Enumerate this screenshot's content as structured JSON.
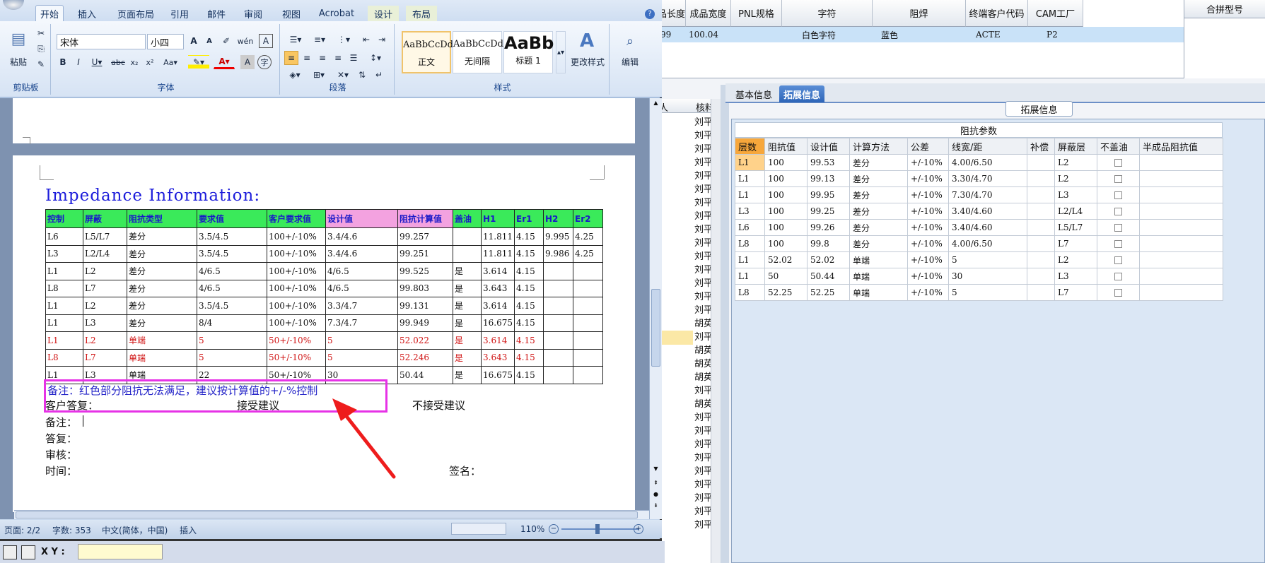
{
  "bg": {
    "top_headers": [
      "品长度",
      "成品宽度",
      "PNL规格",
      "字符",
      "阻焊",
      "终端客户代码",
      "CAM工厂"
    ],
    "top_row": [
      "99",
      "100.04",
      "",
      "白色字符",
      "蓝色",
      "ACTE",
      "P2"
    ],
    "right_header": "合拼型号",
    "mid_headers": [
      "人",
      "核料"
    ],
    "mid_names": [
      "刘平",
      "刘平",
      "刘平",
      "刘平",
      "刘平",
      "刘平",
      "刘平",
      "刘平",
      "刘平",
      "刘平",
      "刘平",
      "刘平",
      "刘平",
      "刘平",
      "刘平",
      "胡英",
      "刘平",
      "胡英",
      "胡英",
      "胡英",
      "刘平",
      "胡英",
      "刘平",
      "刘平",
      "刘平",
      "刘平",
      "刘平",
      "刘平",
      "刘平",
      "刘平",
      "刘平"
    ],
    "tabs": [
      "基本信息",
      "拓展信息"
    ],
    "legend": "拓展信息",
    "grid_title": "阻抗参数",
    "grid_headers": [
      "层数",
      "阻抗值",
      "设计值",
      "计算方法",
      "公差",
      "线宽/距",
      "补偿",
      "屏蔽层",
      "不盖油",
      "半成品阻抗值"
    ],
    "grid_rows": [
      [
        "L1",
        "100",
        "99.53",
        "差分",
        "+/-10%",
        "4.00/6.50",
        "",
        "L2"
      ],
      [
        "L1",
        "100",
        "99.13",
        "差分",
        "+/-10%",
        "3.30/4.70",
        "",
        "L2"
      ],
      [
        "L1",
        "100",
        "99.95",
        "差分",
        "+/-10%",
        "7.30/4.70",
        "",
        "L3"
      ],
      [
        "L3",
        "100",
        "99.25",
        "差分",
        "+/-10%",
        "3.40/4.60",
        "",
        "L2/L4"
      ],
      [
        "L6",
        "100",
        "99.26",
        "差分",
        "+/-10%",
        "3.40/4.60",
        "",
        "L5/L7"
      ],
      [
        "L8",
        "100",
        "99.8",
        "差分",
        "+/-10%",
        "4.00/6.50",
        "",
        "L7"
      ],
      [
        "L1",
        "52.02",
        "52.02",
        "单端",
        "+/-10%",
        "5",
        "",
        "L2"
      ],
      [
        "L1",
        "50",
        "50.44",
        "单端",
        "+/-10%",
        "30",
        "",
        "L3"
      ],
      [
        "L8",
        "52.25",
        "52.25",
        "单端",
        "+/-10%",
        "5",
        "",
        "L7"
      ]
    ],
    "bottom_label": "X Y :"
  },
  "word": {
    "tabs": [
      "开始",
      "插入",
      "页面布局",
      "引用",
      "邮件",
      "审阅",
      "视图",
      "Acrobat",
      "设计",
      "布局"
    ],
    "font_name": "宋体",
    "font_size": "小四",
    "groups": [
      "剪贴板",
      "字体",
      "段落",
      "样式"
    ],
    "paste": "粘贴",
    "styles": [
      {
        "preview": "AaBbCcDd",
        "name": "正文"
      },
      {
        "preview": "AaBbCcDd",
        "name": "无间隔"
      },
      {
        "preview": "AaBb",
        "name": "标题 1"
      }
    ],
    "change_style": "更改样式",
    "edit": "编辑",
    "doc_title": "Impedance Information:",
    "table_headers": [
      "控制",
      "屏蔽",
      "阻抗类型",
      "要求值",
      "客户要求值",
      "设计值",
      "阻抗计算值",
      "盖油",
      "H1",
      "Er1",
      "H2",
      "Er2"
    ],
    "table_rows": [
      {
        "red": false,
        "cells": [
          "L6",
          "L5/L7",
          "差分",
          "3.5/4.5",
          "100+/-10%",
          "3.4/4.6",
          "99.257",
          "",
          "11.811",
          "4.15",
          "9.995",
          "4.25"
        ]
      },
      {
        "red": false,
        "cells": [
          "L3",
          "L2/L4",
          "差分",
          "3.5/4.5",
          "100+/-10%",
          "3.4/4.6",
          "99.251",
          "",
          "11.811",
          "4.15",
          "9.986",
          "4.25"
        ]
      },
      {
        "red": false,
        "cells": [
          "L1",
          "L2",
          "差分",
          "4/6.5",
          "100+/-10%",
          "4/6.5",
          "99.525",
          "是",
          "3.614",
          "4.15",
          "",
          ""
        ]
      },
      {
        "red": false,
        "cells": [
          "L8",
          "L7",
          "差分",
          "4/6.5",
          "100+/-10%",
          "4/6.5",
          "99.803",
          "是",
          "3.643",
          "4.15",
          "",
          ""
        ]
      },
      {
        "red": false,
        "cells": [
          "L1",
          "L2",
          "差分",
          "3.5/4.5",
          "100+/-10%",
          "3.3/4.7",
          "99.131",
          "是",
          "3.614",
          "4.15",
          "",
          ""
        ]
      },
      {
        "red": false,
        "cells": [
          "L1",
          "L3",
          "差分",
          "8/4",
          "100+/-10%",
          "7.3/4.7",
          "99.949",
          "是",
          "16.675",
          "4.15",
          "",
          ""
        ]
      },
      {
        "red": true,
        "cells": [
          "L1",
          "L2",
          "单端",
          "5",
          "50+/-10%",
          "5",
          "52.022",
          "是",
          "3.614",
          "4.15",
          "",
          ""
        ]
      },
      {
        "red": true,
        "cells": [
          "L8",
          "L7",
          "单端",
          "5",
          "50+/-10%",
          "5",
          "52.246",
          "是",
          "3.643",
          "4.15",
          "",
          ""
        ]
      },
      {
        "red": false,
        "cells": [
          "L1",
          "L3",
          "单端",
          "22",
          "50+/-10%",
          "30",
          "50.44",
          "是",
          "16.675",
          "4.15",
          "",
          ""
        ]
      }
    ],
    "note": "备注：红色部分阻抗无法满足，建议按计算值的+/-%控制",
    "customer_reply": "客户答复：",
    "accept": "接受建议",
    "reject": "不接受建议",
    "remark": "备注：",
    "answer": "答复：",
    "review": "审核：",
    "time": "时间：",
    "sign": "签名：",
    "status": {
      "page": "页面: 2/2",
      "words": "字数: 353",
      "lang": "中文(简体，中国)",
      "mode": "插入",
      "zoom": "110%"
    }
  }
}
